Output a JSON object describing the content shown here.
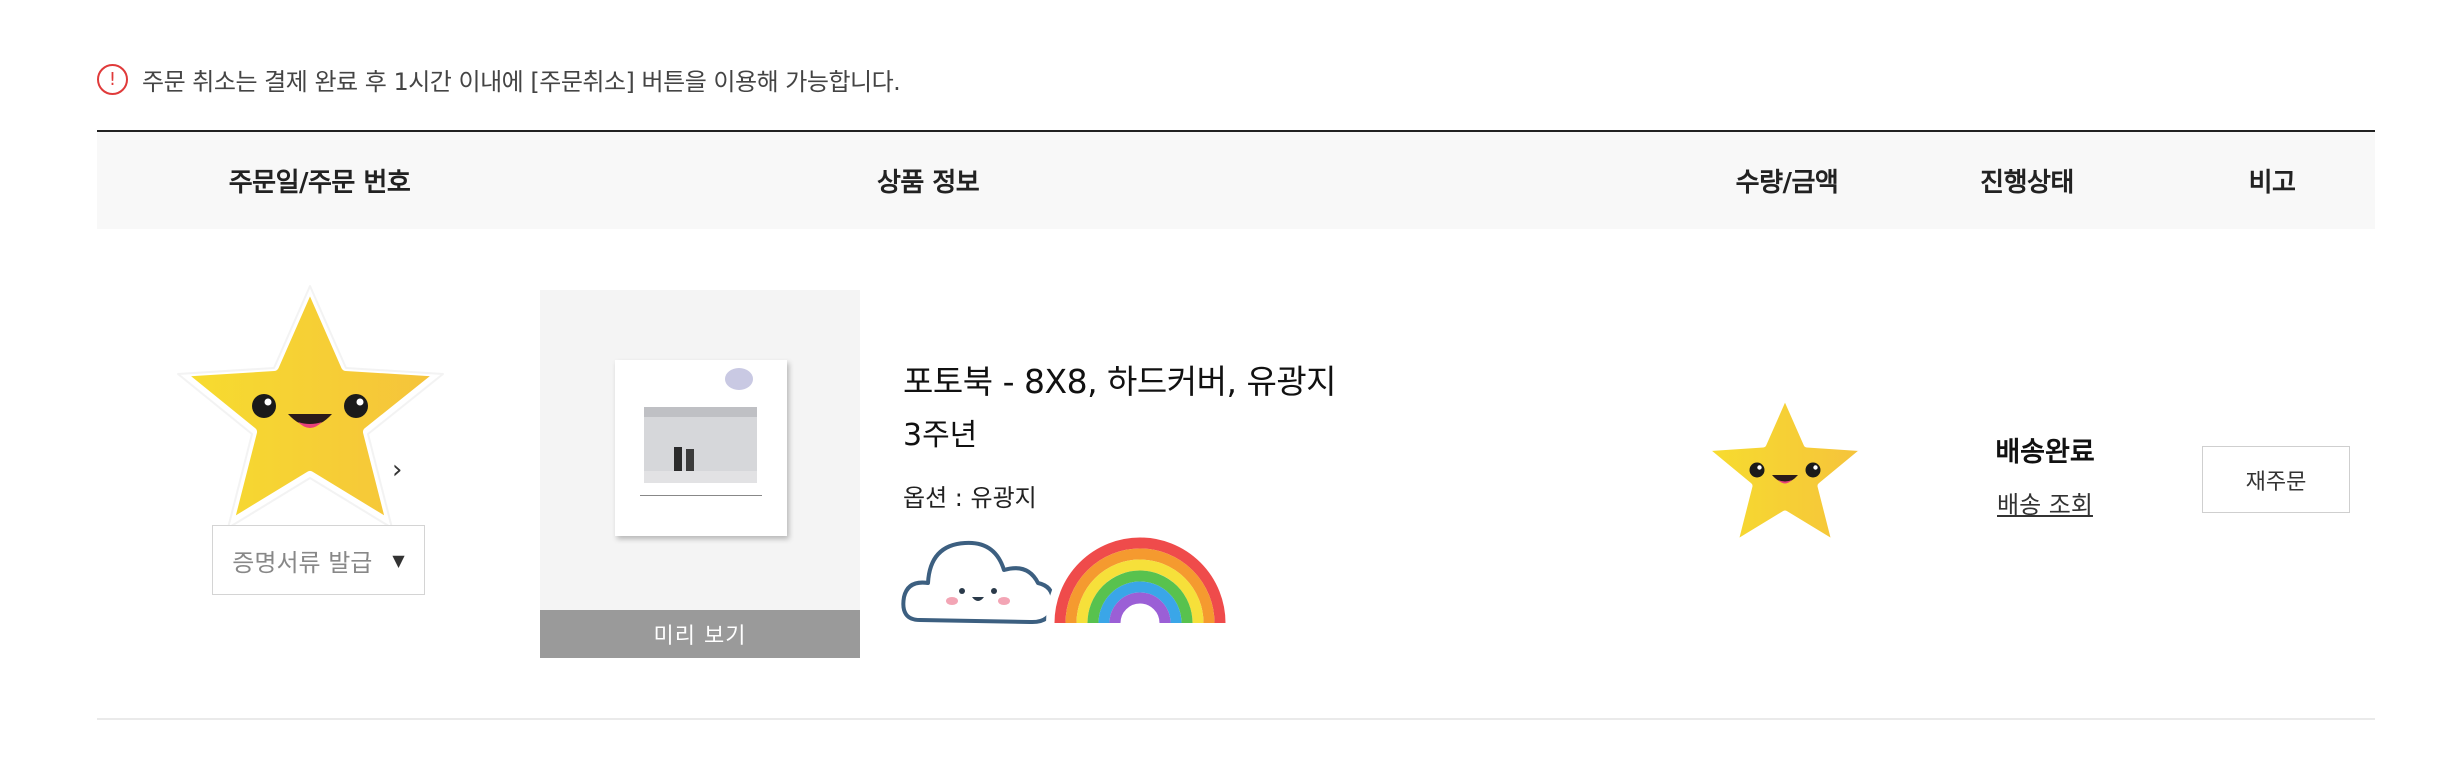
{
  "notice": {
    "icon": "exclamation-circle-icon",
    "text": "주문 취소는 결제 완료 후 1시간 이내에 [주문취소] 버튼을 이용해 가능합니다."
  },
  "table": {
    "headers": {
      "date": "주문일/주문 번호",
      "product": "상품 정보",
      "qty": "수량/금액",
      "status": "진행상태",
      "note": "비고"
    }
  },
  "order": {
    "cert_button": "증명서류 발급",
    "preview_button": "미리 보기",
    "product_title": "포토북 - 8X8, 하드커버, 유광지",
    "product_subtitle": "3주년",
    "product_option": "옵션 : 유광지",
    "status": "배송완료",
    "track_link": "배송 조회",
    "reorder_button": "재주문"
  },
  "colors": {
    "alert": "#e03a3a",
    "preview_bg": "#9a9a9a",
    "header_bg": "#f8f8f8"
  }
}
